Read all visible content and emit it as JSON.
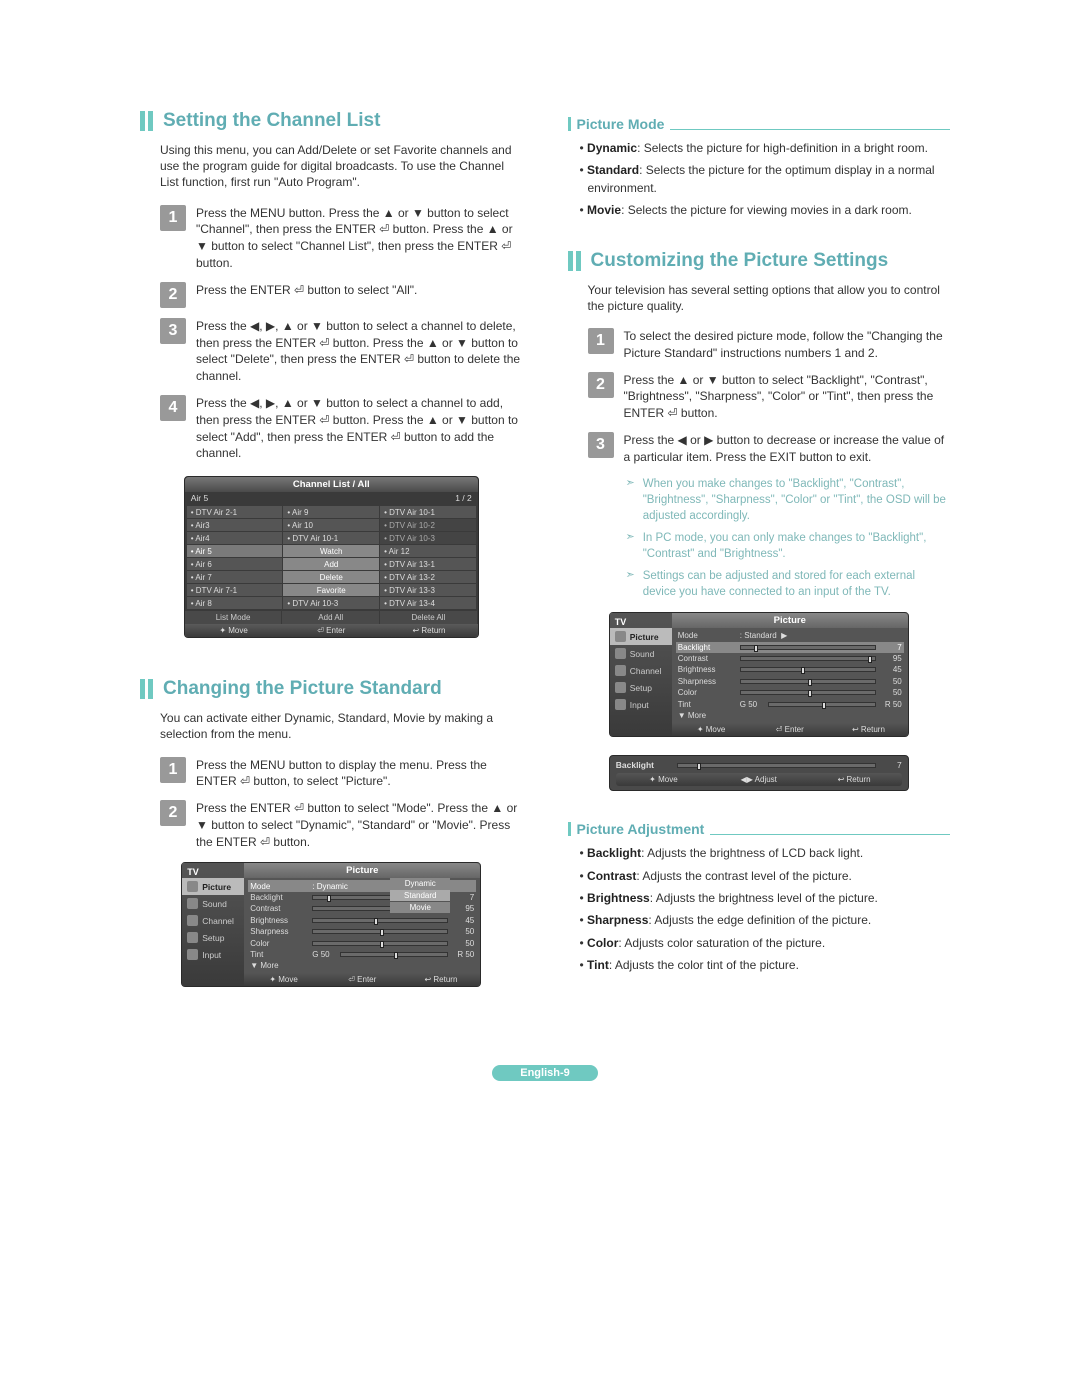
{
  "footer": "English-9",
  "left": {
    "s1": {
      "title": "Setting the Channel List",
      "intro": "Using this menu, you can Add/Delete or set Favorite channels and use the program guide for digital broadcasts. To use the Channel List function, first run \"Auto Program\".",
      "steps": [
        "Press the MENU button. Press the ▲ or ▼ button to select \"Channel\", then press the ENTER ⏎ button. Press the ▲ or ▼ button to select \"Channel List\", then press the ENTER ⏎ button.",
        "Press the ENTER ⏎ button to select \"All\".",
        "Press the ◀, ▶, ▲ or ▼ button to select a channel to delete, then press the ENTER ⏎ button. Press the ▲ or ▼ button to select \"Delete\", then press the ENTER ⏎ button to delete the channel.",
        "Press the ◀, ▶, ▲ or ▼ button to select a channel to add, then press the ENTER ⏎ button. Press the ▲ or ▼ button to select \"Add\", then press the ENTER ⏎ button to add the channel."
      ],
      "osd": {
        "title": "Channel List / All",
        "sub": "Air 5",
        "pager": "1 / 2",
        "rows": [
          [
            "DTV Air 2-1",
            "Air 9",
            "DTV Air 10-1"
          ],
          [
            "Air3",
            "Air 10",
            "DTV Air 10-2"
          ],
          [
            "Air4",
            "DTV Air 10-1",
            "DTV Air 10-3"
          ],
          [
            "Air 5",
            "Watch",
            "Air 12"
          ],
          [
            "Air 6",
            "Add",
            "DTV Air 13-1"
          ],
          [
            "Air 7",
            "Delete",
            "DTV Air 13-2"
          ],
          [
            "DTV Air 7-1",
            "Favorite",
            "DTV Air 13-3"
          ],
          [
            "Air 8",
            "DTV Air 10-3",
            "DTV Air 13-4"
          ]
        ],
        "actions": [
          "List Mode",
          "Add All",
          "Delete All"
        ],
        "bottom": [
          "✦ Move",
          "⏎ Enter",
          "↩ Return"
        ]
      }
    },
    "s2": {
      "title": "Changing the Picture Standard",
      "intro": "You can activate either Dynamic, Standard, Movie by making a selection from the menu.",
      "steps": [
        "Press the MENU button to display the menu. Press the ENTER ⏎ button, to select \"Picture\".",
        "Press the ENTER ⏎ button to select \"Mode\". Press the ▲ or ▼ button to select \"Dynamic\", \"Standard\" or \"Movie\". Press the ENTER ⏎ button."
      ],
      "osd": {
        "side_header": "TV",
        "side": [
          "Picture",
          "Sound",
          "Channel",
          "Setup",
          "Input"
        ],
        "title": "Picture",
        "mode_label": "Mode",
        "mode_value": "Dynamic",
        "popup": [
          "Dynamic",
          "Standard",
          "Movie"
        ],
        "lines": [
          {
            "label": "Backlight",
            "pos": 10,
            "val": "7"
          },
          {
            "label": "Contrast",
            "pos": 95,
            "val": "95"
          },
          {
            "label": "Brightness",
            "pos": 45,
            "val": "45"
          },
          {
            "label": "Sharpness",
            "pos": 50,
            "val": "50"
          },
          {
            "label": "Color",
            "pos": 50,
            "val": "50"
          }
        ],
        "tint": {
          "label": "Tint",
          "g": "G 50",
          "r": "R 50",
          "pos": 50
        },
        "more": "▼ More",
        "bottom": [
          "✦ Move",
          "⏎ Enter",
          "↩ Return"
        ]
      }
    }
  },
  "right": {
    "pm": {
      "title": "Picture Mode",
      "bullets": [
        {
          "b": "Dynamic",
          "t": ": Selects the picture for high-definition in a bright room."
        },
        {
          "b": "Standard",
          "t": ": Selects the picture for the optimum display in a normal environment."
        },
        {
          "b": "Movie",
          "t": ": Selects the picture for viewing movies in a dark room."
        }
      ]
    },
    "s1": {
      "title": "Customizing the Picture Settings",
      "intro": "Your television has several setting options that allow you to control the picture quality.",
      "steps": [
        "To select the desired picture mode, follow the \"Changing the Picture Standard\" instructions numbers 1 and 2.",
        "Press the ▲ or ▼ button to select \"Backlight\", \"Contrast\", \"Brightness\", \"Sharpness\", \"Color\" or \"Tint\", then press the ENTER ⏎ button.",
        "Press the ◀ or ▶ button to decrease or increase the value of a particular item. Press the EXIT button to exit."
      ],
      "tips": [
        "When you make changes to \"Backlight\", \"Contrast\", \"Brightness\", \"Sharpness\", \"Color\" or \"Tint\", the OSD will be adjusted accordingly.",
        "In PC mode, you can only make changes to \"Backlight\", \"Contrast\" and \"Brightness\".",
        "Settings can be adjusted and stored for each external device you have connected to an input of the TV."
      ],
      "osd": {
        "side_header": "TV",
        "side": [
          "Picture",
          "Sound",
          "Channel",
          "Setup",
          "Input"
        ],
        "title": "Picture",
        "mode_label": "Mode",
        "mode_value": "Standard",
        "lines": [
          {
            "label": "Backlight",
            "pos": 10,
            "val": "7",
            "sel": true
          },
          {
            "label": "Contrast",
            "pos": 95,
            "val": "95"
          },
          {
            "label": "Brightness",
            "pos": 45,
            "val": "45"
          },
          {
            "label": "Sharpness",
            "pos": 50,
            "val": "50"
          },
          {
            "label": "Color",
            "pos": 50,
            "val": "50"
          }
        ],
        "tint": {
          "label": "Tint",
          "g": "G 50",
          "r": "R 50",
          "pos": 50
        },
        "more": "▼ More",
        "bottom": [
          "✦ Move",
          "⏎ Enter",
          "↩ Return"
        ]
      },
      "osd_bar": {
        "label": "Backlight",
        "val": "7",
        "pos": 10,
        "bottom": [
          "✦ Move",
          "◀▶ Adjust",
          "↩ Return"
        ]
      }
    },
    "pa": {
      "title": "Picture Adjustment",
      "bullets": [
        {
          "b": "Backlight",
          "t": ": Adjusts the brightness of LCD back light."
        },
        {
          "b": "Contrast",
          "t": ": Adjusts the contrast level of the picture."
        },
        {
          "b": "Brightness",
          "t": ": Adjusts the brightness level of the picture."
        },
        {
          "b": "Sharpness",
          "t": ": Adjusts the edge definition of the picture."
        },
        {
          "b": "Color",
          "t": ": Adjusts color saturation of the picture."
        },
        {
          "b": "Tint",
          "t": ": Adjusts the color tint of the picture."
        }
      ]
    }
  }
}
